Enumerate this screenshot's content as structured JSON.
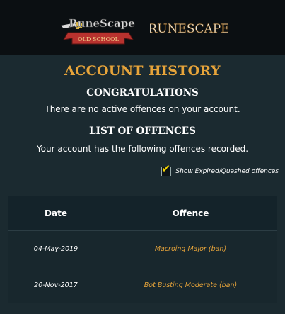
{
  "header": {
    "osrs_logo_name": "RuneScape",
    "osrs_logo_ribbon": "OLD SCHOOL",
    "rs_logo": "RUNESCAPE"
  },
  "page": {
    "title": "ACCOUNT HISTORY",
    "congrats_heading": "CONGRATULATIONS",
    "congrats_message": "There are no active offences on your account.",
    "offences_heading": "LIST OF OFFENCES",
    "offences_message": "Your account has the following offences recorded."
  },
  "filter": {
    "label": "Show Expired/Quashed offences",
    "checked": true
  },
  "table": {
    "headers": {
      "date": "Date",
      "offence": "Offence"
    },
    "rows": [
      {
        "date": "04-May-2019",
        "offence": "Macroing Major (ban)"
      },
      {
        "date": "20-Nov-2017",
        "offence": "Bot Busting Moderate (ban)"
      }
    ]
  },
  "colors": {
    "accent": "#e7a43a",
    "background": "#1c2a30",
    "topbar": "#0b0f12",
    "checkmark": "#f5d400"
  }
}
